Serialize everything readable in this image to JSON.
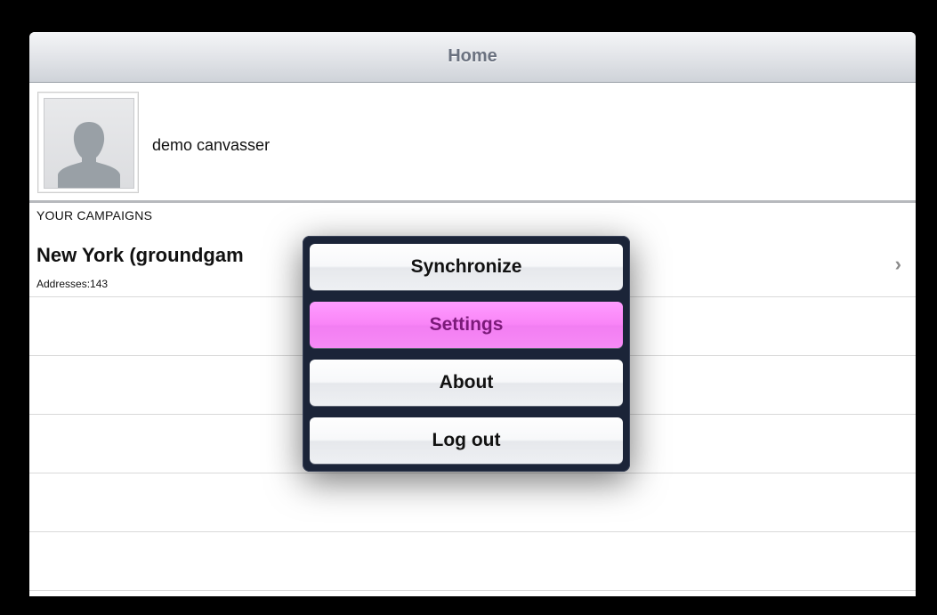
{
  "navbar": {
    "title": "Home"
  },
  "profile": {
    "name": "demo canvasser",
    "avatar_icon": "person-silhouette-icon"
  },
  "campaigns": {
    "section_header": "YOUR CAMPAIGNS",
    "items": [
      {
        "title": "New York (groundgam",
        "subtitle": "Addresses:143",
        "chevron": "›"
      }
    ]
  },
  "menu": {
    "items": [
      {
        "label": "Synchronize",
        "selected": false
      },
      {
        "label": "Settings",
        "selected": true
      },
      {
        "label": "About",
        "selected": false
      },
      {
        "label": "Log out",
        "selected": false
      }
    ],
    "selected_color": "#f985f7"
  }
}
